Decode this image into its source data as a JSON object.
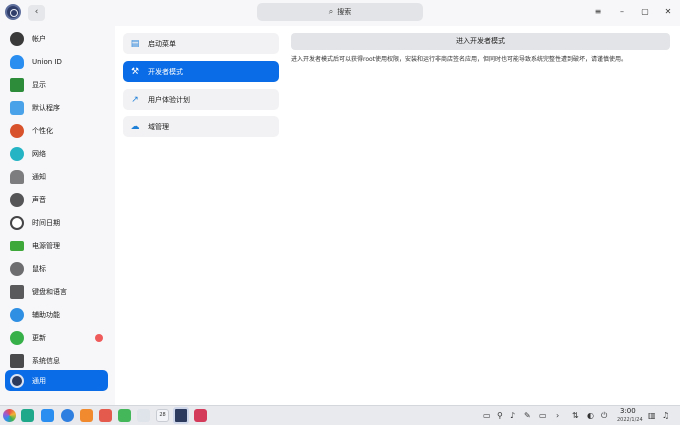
{
  "titlebar": {
    "search_placeholder": "搜索",
    "back_label": "‹",
    "menu_label": "≡",
    "min_label": "–",
    "max_label": "▢",
    "close_label": "✕"
  },
  "sidebar": {
    "items": [
      {
        "label": "帐户",
        "icon": "account-icon",
        "color": "#3a3a3a"
      },
      {
        "label": "Union ID",
        "icon": "cloud-icon",
        "color": "#2a8ef0"
      },
      {
        "label": "显示",
        "icon": "display-icon",
        "color": "#2c8c3a"
      },
      {
        "label": "默认程序",
        "icon": "default-apps-icon",
        "color": "#4aa2e8"
      },
      {
        "label": "个性化",
        "icon": "personalization-icon",
        "color": "#d8532c"
      },
      {
        "label": "网络",
        "icon": "network-icon",
        "color": "#25b4c4"
      },
      {
        "label": "通知",
        "icon": "notification-icon",
        "color": "#7d7d80"
      },
      {
        "label": "声音",
        "icon": "sound-icon",
        "color": "#555558"
      },
      {
        "label": "时间日期",
        "icon": "clock-icon",
        "color": "#444447"
      },
      {
        "label": "电源管理",
        "icon": "power-icon",
        "color": "#3ea83a"
      },
      {
        "label": "鼠标",
        "icon": "mouse-icon",
        "color": "#6d6d70"
      },
      {
        "label": "键盘和语言",
        "icon": "keyboard-icon",
        "color": "#5a5a5d"
      },
      {
        "label": "辅助功能",
        "icon": "accessibility-icon",
        "color": "#2f8fe3"
      },
      {
        "label": "更新",
        "icon": "update-icon",
        "color": "#38b04a"
      },
      {
        "label": "系统信息",
        "icon": "system-info-icon",
        "color": "#4a4a4d"
      },
      {
        "label": "通用",
        "icon": "general-icon",
        "color": "#2c3a5e"
      }
    ],
    "active": "通用",
    "update_badge": true
  },
  "submenu": {
    "items": [
      {
        "label": "启动菜单",
        "icon": "boot-menu-icon"
      },
      {
        "label": "开发者模式",
        "icon": "developer-tools-icon"
      },
      {
        "label": "用户体验计划",
        "icon": "chart-trend-icon"
      },
      {
        "label": "域管理",
        "icon": "domain-icon"
      }
    ],
    "active": "开发者模式"
  },
  "content": {
    "button_label": "进入开发者模式",
    "description": "进入开发者模式后可以获得root使用权限，安装和运行非商店签名应用，但同时也可能导致系统完整性遭到破坏，请谨慎使用。"
  },
  "dock": {
    "time": "3:00",
    "date": "2022/1/24",
    "calendar_day": "28"
  }
}
